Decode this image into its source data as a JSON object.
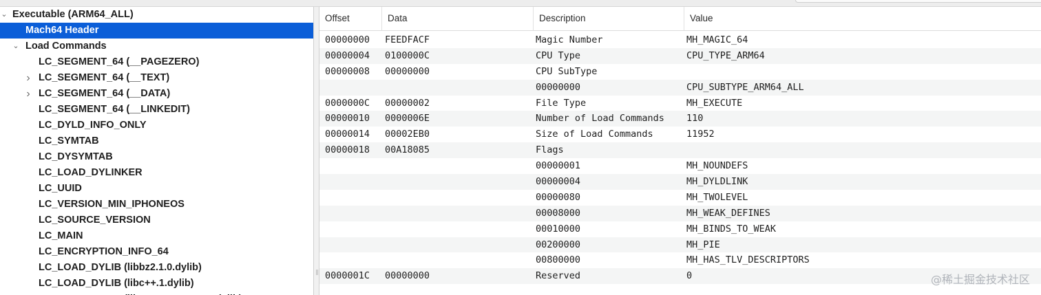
{
  "tree": [
    {
      "label": "Executable  (ARM64_ALL)",
      "level": 0,
      "chevron": "v",
      "selected": false
    },
    {
      "label": "Mach64 Header",
      "level": 1,
      "chevron": "",
      "selected": true
    },
    {
      "label": "Load Commands",
      "level": 1,
      "chevron": "v",
      "selected": false
    },
    {
      "label": "LC_SEGMENT_64 (__PAGEZERO)",
      "level": 2,
      "chevron": "",
      "selected": false
    },
    {
      "label": "LC_SEGMENT_64 (__TEXT)",
      "level": 2,
      "chevron": ">",
      "selected": false
    },
    {
      "label": "LC_SEGMENT_64 (__DATA)",
      "level": 2,
      "chevron": ">",
      "selected": false
    },
    {
      "label": "LC_SEGMENT_64 (__LINKEDIT)",
      "level": 2,
      "chevron": "",
      "selected": false
    },
    {
      "label": "LC_DYLD_INFO_ONLY",
      "level": 2,
      "chevron": "",
      "selected": false
    },
    {
      "label": "LC_SYMTAB",
      "level": 2,
      "chevron": "",
      "selected": false
    },
    {
      "label": "LC_DYSYMTAB",
      "level": 2,
      "chevron": "",
      "selected": false
    },
    {
      "label": "LC_LOAD_DYLINKER",
      "level": 2,
      "chevron": "",
      "selected": false
    },
    {
      "label": "LC_UUID",
      "level": 2,
      "chevron": "",
      "selected": false
    },
    {
      "label": "LC_VERSION_MIN_IPHONEOS",
      "level": 2,
      "chevron": "",
      "selected": false
    },
    {
      "label": "LC_SOURCE_VERSION",
      "level": 2,
      "chevron": "",
      "selected": false
    },
    {
      "label": "LC_MAIN",
      "level": 2,
      "chevron": "",
      "selected": false
    },
    {
      "label": "LC_ENCRYPTION_INFO_64",
      "level": 2,
      "chevron": "",
      "selected": false
    },
    {
      "label": "LC_LOAD_DYLIB (libbz2.1.0.dylib)",
      "level": 2,
      "chevron": "",
      "selected": false
    },
    {
      "label": "LC_LOAD_DYLIB (libc++.1.dylib)",
      "level": 2,
      "chevron": "",
      "selected": false
    },
    {
      "label": "LC_LOAD_DYLIB (libcommonCrypto.dylib)",
      "level": 2,
      "chevron": "",
      "selected": false
    }
  ],
  "table": {
    "columns": [
      "Offset",
      "Data",
      "Description",
      "Value"
    ],
    "rows": [
      {
        "offset": "00000000",
        "data": "FEEDFACF",
        "description": "Magic Number",
        "value": "MH_MAGIC_64"
      },
      {
        "offset": "00000004",
        "data": "0100000C",
        "description": "CPU Type",
        "value": "CPU_TYPE_ARM64"
      },
      {
        "offset": "00000008",
        "data": "00000000",
        "description": "CPU SubType",
        "value": ""
      },
      {
        "offset": "",
        "data": "",
        "description": "00000000",
        "value": "CPU_SUBTYPE_ARM64_ALL"
      },
      {
        "offset": "0000000C",
        "data": "00000002",
        "description": "File Type",
        "value": "MH_EXECUTE"
      },
      {
        "offset": "00000010",
        "data": "0000006E",
        "description": "Number of Load Commands",
        "value": "110"
      },
      {
        "offset": "00000014",
        "data": "00002EB0",
        "description": "Size of Load Commands",
        "value": "11952"
      },
      {
        "offset": "00000018",
        "data": "00A18085",
        "description": "Flags",
        "value": ""
      },
      {
        "offset": "",
        "data": "",
        "description": "00000001",
        "value": "MH_NOUNDEFS"
      },
      {
        "offset": "",
        "data": "",
        "description": "00000004",
        "value": "MH_DYLDLINK"
      },
      {
        "offset": "",
        "data": "",
        "description": "00000080",
        "value": "MH_TWOLEVEL"
      },
      {
        "offset": "",
        "data": "",
        "description": "00008000",
        "value": "MH_WEAK_DEFINES"
      },
      {
        "offset": "",
        "data": "",
        "description": "00010000",
        "value": "MH_BINDS_TO_WEAK"
      },
      {
        "offset": "",
        "data": "",
        "description": "00200000",
        "value": "MH_PIE"
      },
      {
        "offset": "",
        "data": "",
        "description": "00800000",
        "value": "MH_HAS_TLV_DESCRIPTORS"
      },
      {
        "offset": "0000001C",
        "data": "00000000",
        "description": "Reserved",
        "value": "0"
      }
    ]
  },
  "watermark": "@稀土掘金技术社区",
  "colors": {
    "selection": "#0b5ed8",
    "stripe": "#f4f5f5",
    "text": "#1e1e1e"
  }
}
